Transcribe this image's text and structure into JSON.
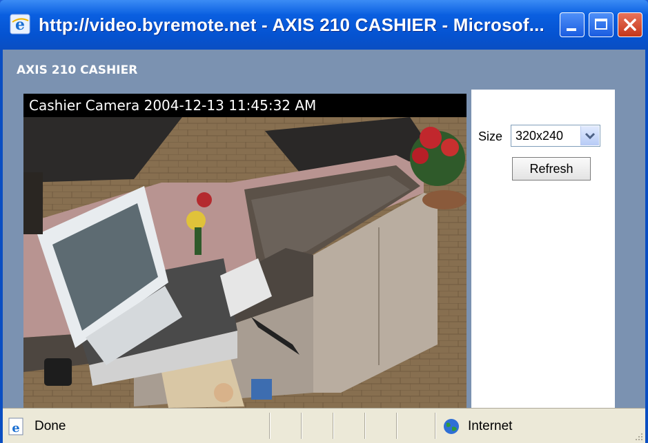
{
  "window": {
    "title": "http://video.byremote.net - AXIS 210 CASHIER - Microsof...",
    "accent": "#0a5fe0"
  },
  "page": {
    "heading": "AXIS 210 CASHIER"
  },
  "camera": {
    "overlay_text": "Cashier Camera 2004-12-13 11:45:32 AM"
  },
  "controls": {
    "size_label": "Size",
    "size_selected": "320x240",
    "refresh_label": "Refresh"
  },
  "statusbar": {
    "status": "Done",
    "zone": "Internet"
  },
  "icons": {
    "titlebar": "internet-explorer-icon",
    "status": "internet-explorer-page-icon",
    "zone": "globe-icon"
  }
}
